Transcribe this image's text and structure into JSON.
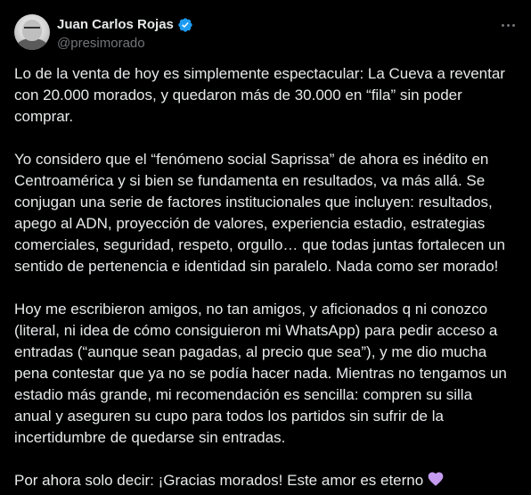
{
  "post": {
    "author": {
      "display_name": "Juan Carlos Rojas",
      "handle": "@presimorado",
      "verified": true,
      "verified_color": "#1d9bf0"
    },
    "more_icon": "more-horizontal-icon",
    "paragraphs": [
      "Lo de la venta de hoy es simplemente espectacular: La Cueva a reventar\ncon 20.000 morados, y quedaron más de 30.000 en “fila” sin poder\ncomprar.",
      "Yo considero que el “fenómeno social Saprissa” de ahora es inédito en\nCentroamérica y si bien se fundamenta en resultados, va más allá. Se\nconjugan una serie de factores institucionales que incluyen: resultados,\napego al ADN, proyección de valores, experiencia estadio, estrategias\ncomerciales, seguridad, respeto, orgullo… que todas juntas fortalecen un\nsentido de pertenencia e identidad sin paralelo. Nada como ser morado!",
      "Hoy me escribieron amigos, no tan amigos, y aficionados q ni conozco\n(literal, ni idea de cómo consiguieron mi WhatsApp) para pedir acceso a\nentradas (“aunque sean pagadas, al precio que sea”), y me dio mucha\npena contestar que ya no se podía hacer nada. Mientras no tengamos un\nestadio más grande, mi recomendación es sencilla: compren su silla\nanual y aseguren su cupo para todos los partidos sin sufrir de la\nincertidumbre de quedarse sin entradas."
    ],
    "closing": "Por ahora solo decir: ¡Gracias morados! Este amor es eterno",
    "closing_emoji": "purple-heart-icon",
    "colors": {
      "background": "#000000",
      "text": "#e7e9ea",
      "secondary": "#71767b",
      "heart": "#c59bf0"
    }
  }
}
